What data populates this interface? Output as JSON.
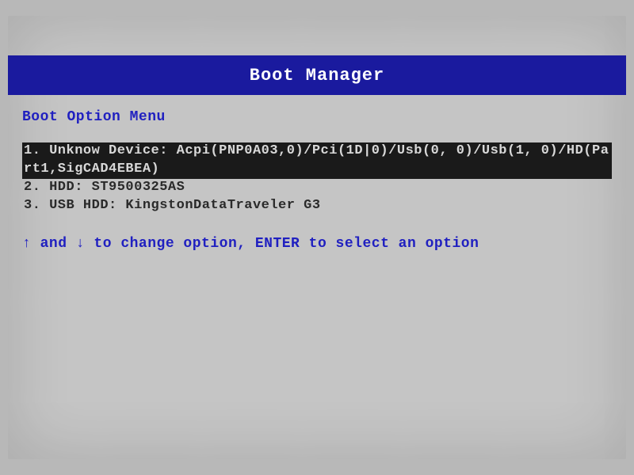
{
  "header": {
    "title": "Boot Manager"
  },
  "menu": {
    "title": "Boot Option Menu",
    "options": [
      {
        "label": "1. Unknow Device: Acpi(PNP0A03,0)/Pci(1D|0)/Usb(0, 0)/Usb(1, 0)/HD(Part1,SigCAD4EBEA)",
        "selected": true
      },
      {
        "label": "2. HDD: ST9500325AS",
        "selected": false
      },
      {
        "label": "3. USB HDD: KingstonDataTraveler G3",
        "selected": false
      }
    ],
    "instructions_prefix": "↑ and ↓ to change option, ENTER to select an option"
  }
}
